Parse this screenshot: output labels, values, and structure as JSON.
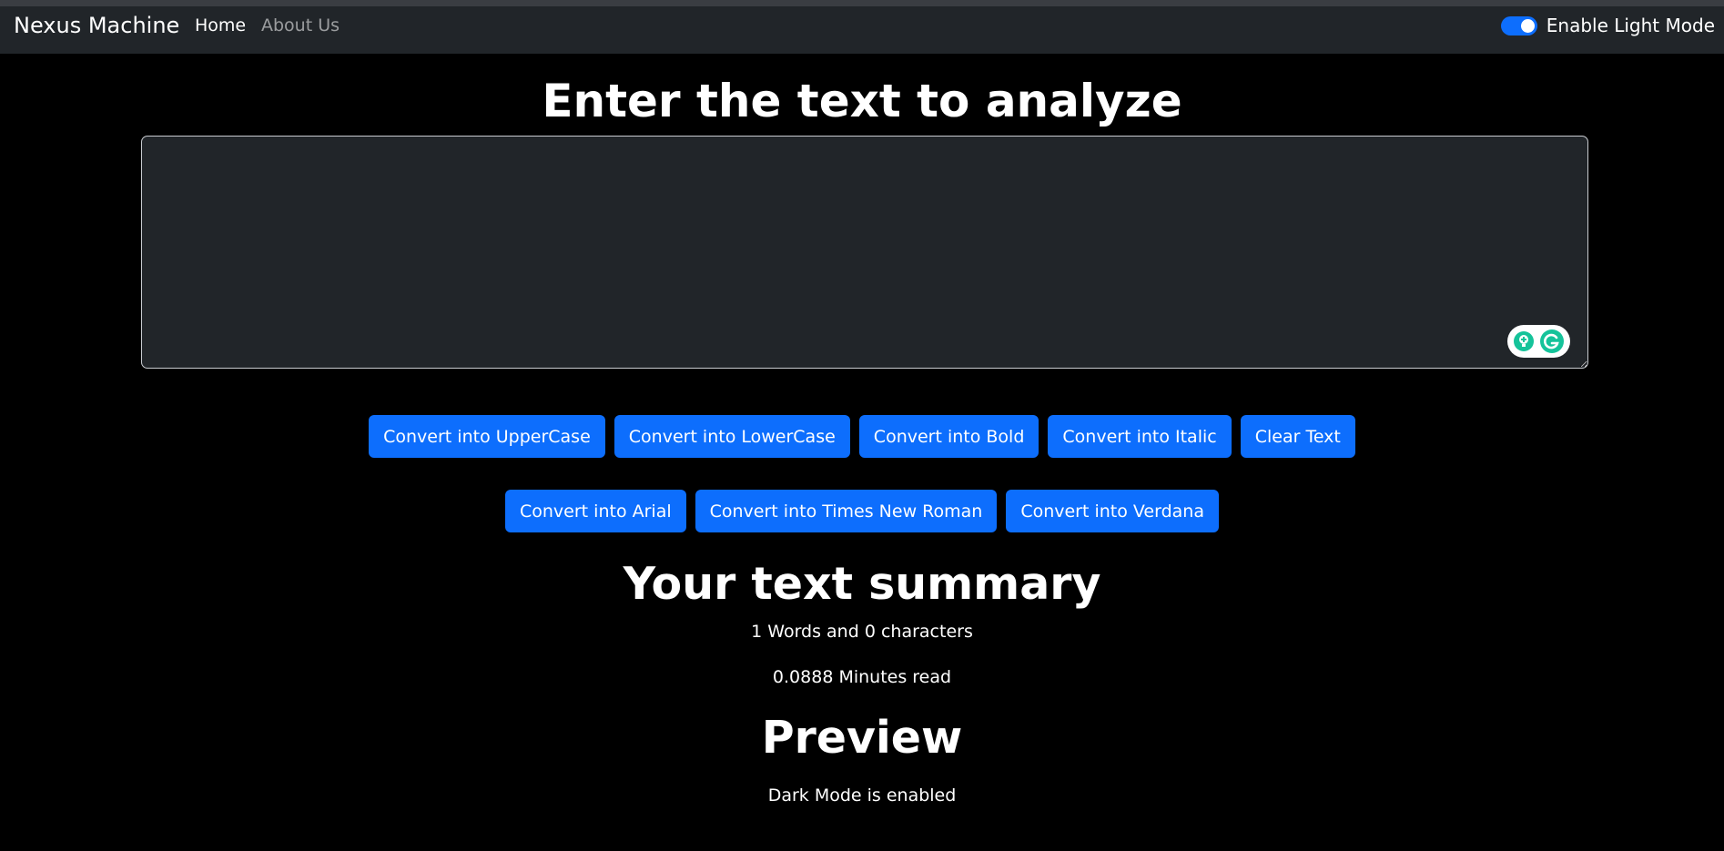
{
  "navbar": {
    "brand": "Nexus Machine",
    "links": [
      "Home",
      "About Us"
    ],
    "toggle_label": "Enable Light Mode",
    "toggle_on": true
  },
  "main": {
    "heading": "Enter the text to analyze",
    "textarea_value": "",
    "buttons_row1": [
      "Convert into UpperCase",
      "Convert into LowerCase",
      "Convert into Bold",
      "Convert into Italic",
      "Clear Text"
    ],
    "buttons_row2": [
      "Convert into Arial",
      "Convert into Times New Roman",
      "Convert into Verdana"
    ]
  },
  "summary": {
    "heading": "Your text summary",
    "words_chars": "1 Words and 0 characters",
    "minutes_read": "0.0888 Minutes read"
  },
  "preview": {
    "heading": "Preview",
    "text": "Dark Mode is enabled"
  },
  "colors": {
    "background": "#000000",
    "navbar": "#212529",
    "accent": "#0d6efd",
    "grammarly": "#15c39a"
  },
  "icons": {
    "grammarly_suggestion": "lightbulb-plus-icon",
    "grammarly_logo": "grammarly-g-icon"
  }
}
